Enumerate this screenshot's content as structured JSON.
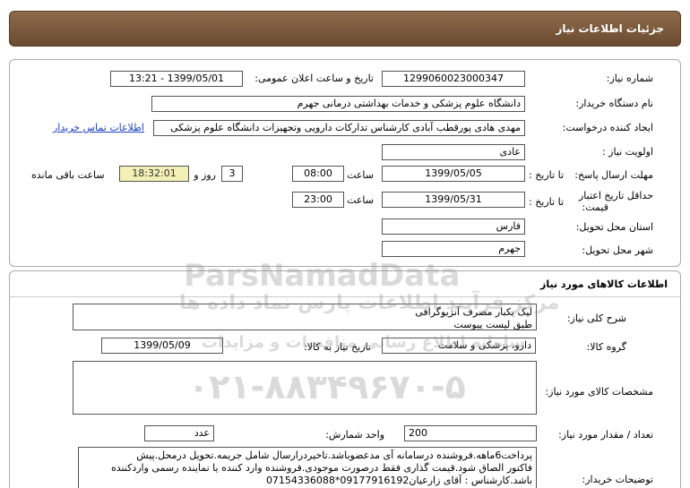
{
  "header": {
    "title": "جزئیات اطلاعات نیاز"
  },
  "need_info": {
    "need_number_label": "شماره نیاز:",
    "need_number": "1299060023000347",
    "announce_label": "تاریخ و ساعت اعلان عمومی:",
    "announce_value": "1399/05/01 - 13:21",
    "buyer_org_label": "نام دستگاه خریدار:",
    "buyer_org": "دانشگاه علوم پزشکی و خدمات بهداشتی درمانی جهرم",
    "requester_label": "ایجاد کننده درخواست:",
    "requester": "مهدی هادی پورقطب آبادی کارشناس تدارکات دارویی وتجهیزات دانشگاه علوم پزشکی",
    "contact_link": "اطلاعات تماس خریدار",
    "priority_label": "اولویت نیاز :",
    "priority": "عادی",
    "deadline_label": "مهلت ارسال پاسخ:",
    "to_date_label": "تا تاریخ :",
    "deadline_date": "1399/05/05",
    "time_label": "ساعت",
    "deadline_time": "08:00",
    "days_value": "3",
    "days_label": "روز و",
    "remaining_time": "18:32:01",
    "remaining_label": "ساعت باقی مانده",
    "validity_label_1": "حداقل تاریخ اعتبار",
    "validity_label_2": "قیمت:",
    "validity_to_label": "تا تاریخ :",
    "validity_date": "1399/05/31",
    "validity_time_label": "ساعت",
    "validity_time": "23:00",
    "province_label": "استان محل تحویل:",
    "province": "فارس",
    "city_label": "شهر محل تحویل:",
    "city": "جهرم"
  },
  "goods": {
    "section_title": "اطلاعات کالاهای مورد نیاز",
    "description_label": "شرح کلی نیاز:",
    "description_line1": "لیک یکبار مصرف آنژیوگرافی",
    "description_line2": "طبق لیست  پیوست",
    "group_label": "گروه کالا:",
    "group": "دارو، پزشکی و سلامت",
    "need_date_label": "تاریخ نیاز به کالا:",
    "need_date": "1399/05/09",
    "specs_label": "مشخصات کالای مورد نیاز:",
    "quantity_label": "تعداد / مقدار مورد نیاز:",
    "quantity": "200",
    "unit_label": "واحد شمارش:",
    "unit": "عدد",
    "buyer_notes_label": "توضیحات خریدار:",
    "notes_line1": "پرداخت6ماهه.فروشنده درسامانه آی مدعضوباشد.تاخیردرارسال شامل جریمه.تحویل درمحل.پیش",
    "notes_line2": "فاکتور الصاق شود.قیمت گذاری فقط درصورت موجودی.فروشنده وارد کننده یا نماینده رسمی واردکننده",
    "notes_line3": "باشد.کارشناس : آقای زارعیان09177916192*07154336088"
  },
  "watermark": {
    "brand": "ParsNamadData",
    "tagline": "مرکز فرآیند اطلاعات پارس نماد داده ها",
    "sub": "سامانه اطلاع رسانی مناقصات و مزایدات",
    "phone": "۰۲۱-۸۸۳۴۹۶۷۰-۵"
  }
}
